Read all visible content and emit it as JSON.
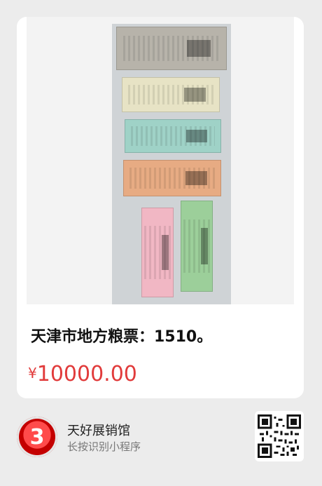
{
  "product": {
    "title": "天津市地方粮票：1510。",
    "price_symbol": "¥",
    "price": "10000.00"
  },
  "shop": {
    "name": "天好展销馆",
    "hint": "长按识别小程序"
  },
  "icons": {
    "logo": "shop-logo-icon",
    "qr": "qr-code-icon"
  },
  "colors": {
    "price": "#e13b3b",
    "background": "#ececec"
  }
}
